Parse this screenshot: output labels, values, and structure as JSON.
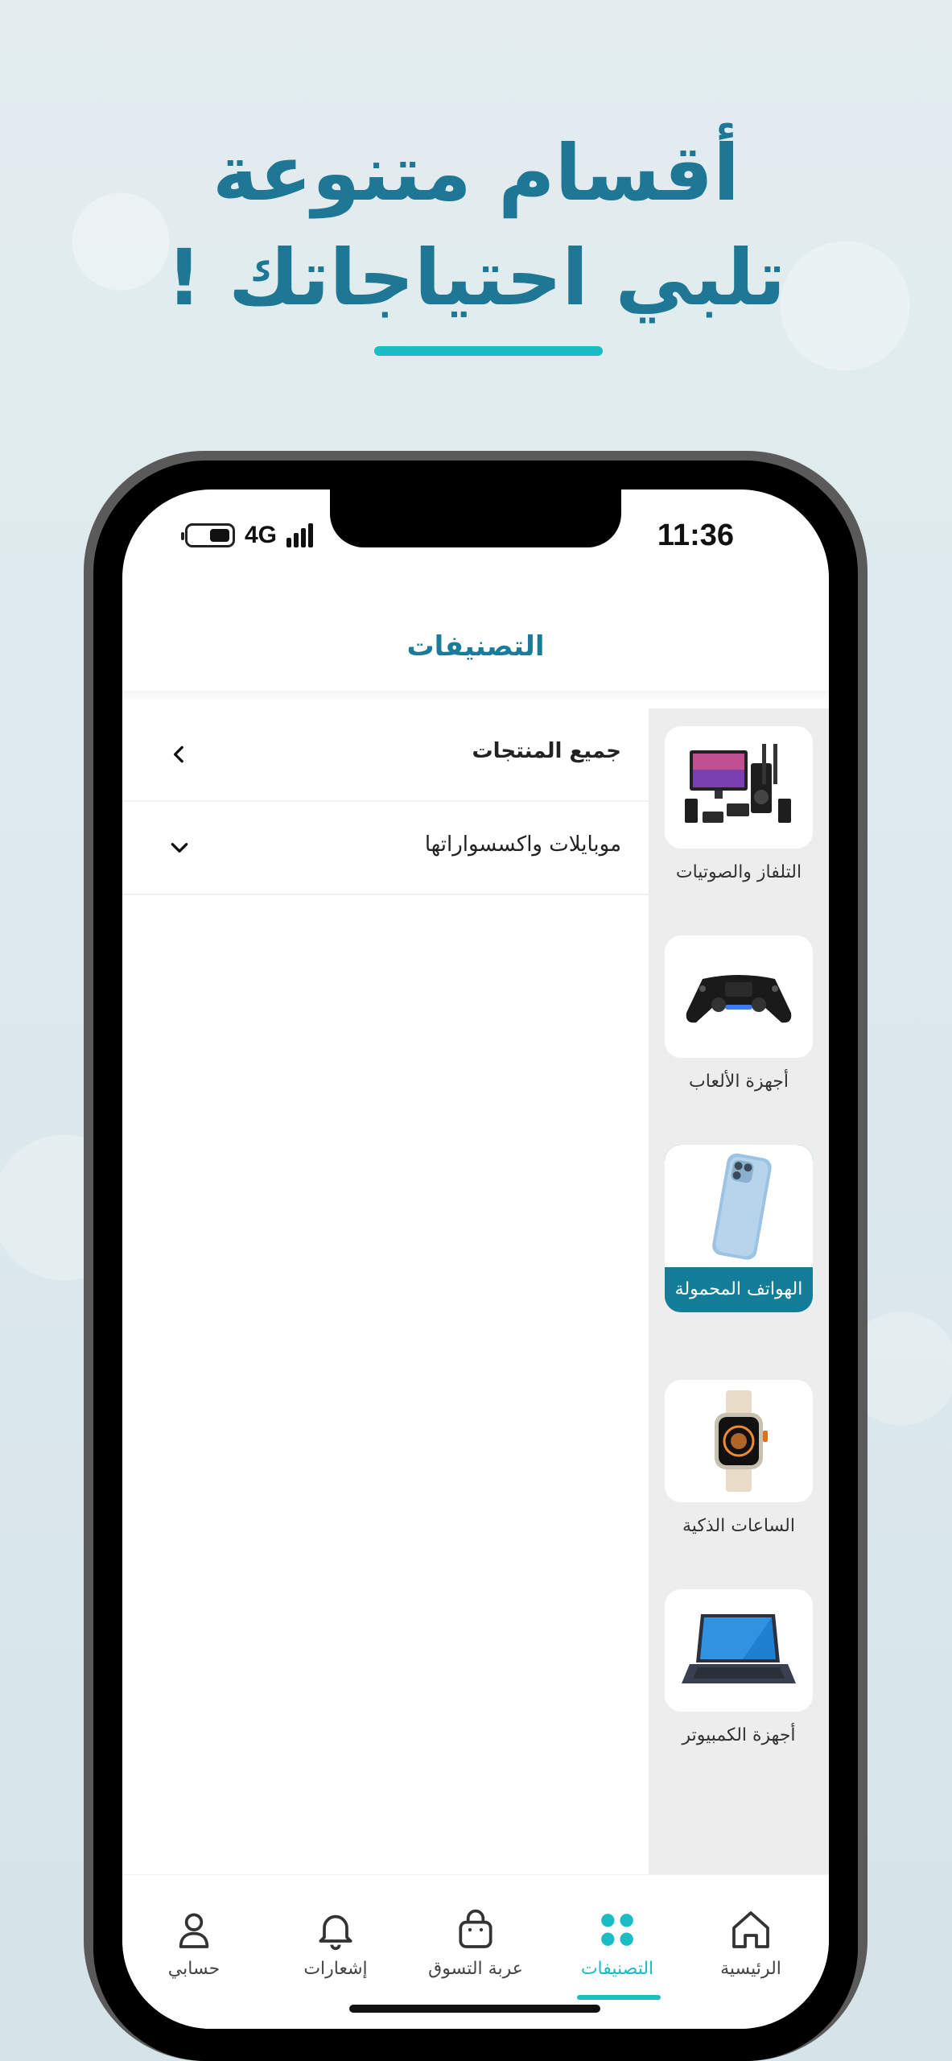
{
  "promo": {
    "headline_line1": "أقسام متنوعة",
    "headline_line2": "تلبي احتياجاتك !"
  },
  "status_bar": {
    "time": "11:36",
    "network": "4G",
    "icons": [
      "battery-icon",
      "signal-icon"
    ]
  },
  "header": {
    "title": "التصنيفات"
  },
  "categories": [
    {
      "label": "التلفاز والصوتيات",
      "icon": "tv-audio-image",
      "active": false
    },
    {
      "label": "أجهزة الألعاب",
      "icon": "gamepad-image",
      "active": false
    },
    {
      "label": "الهواتف المحمولة",
      "icon": "smartphone-image",
      "active": true
    },
    {
      "label": "الساعات الذكية",
      "icon": "smartwatch-image",
      "active": false
    },
    {
      "label": "أجهزة الكمبيوتر",
      "icon": "laptop-image",
      "active": false
    }
  ],
  "subcategories": [
    {
      "label": "جميع المنتجات",
      "icon": "chevron-left-icon"
    },
    {
      "label": "موبايلات واكسسواراتها",
      "icon": "chevron-down-icon"
    }
  ],
  "bottom_nav": [
    {
      "label": "الرئيسية",
      "icon": "home-icon",
      "active": false
    },
    {
      "label": "التصنيفات",
      "icon": "grid-icon",
      "active": true
    },
    {
      "label": "عربة التسوق",
      "icon": "shopping-bag-icon",
      "active": false
    },
    {
      "label": "إشعارات",
      "icon": "bell-icon",
      "active": false
    },
    {
      "label": "حسابي",
      "icon": "user-icon",
      "active": false
    }
  ],
  "colors": {
    "brand": "#1a7c9a",
    "accent": "#1bbcc4",
    "background": "#dde8ec"
  }
}
